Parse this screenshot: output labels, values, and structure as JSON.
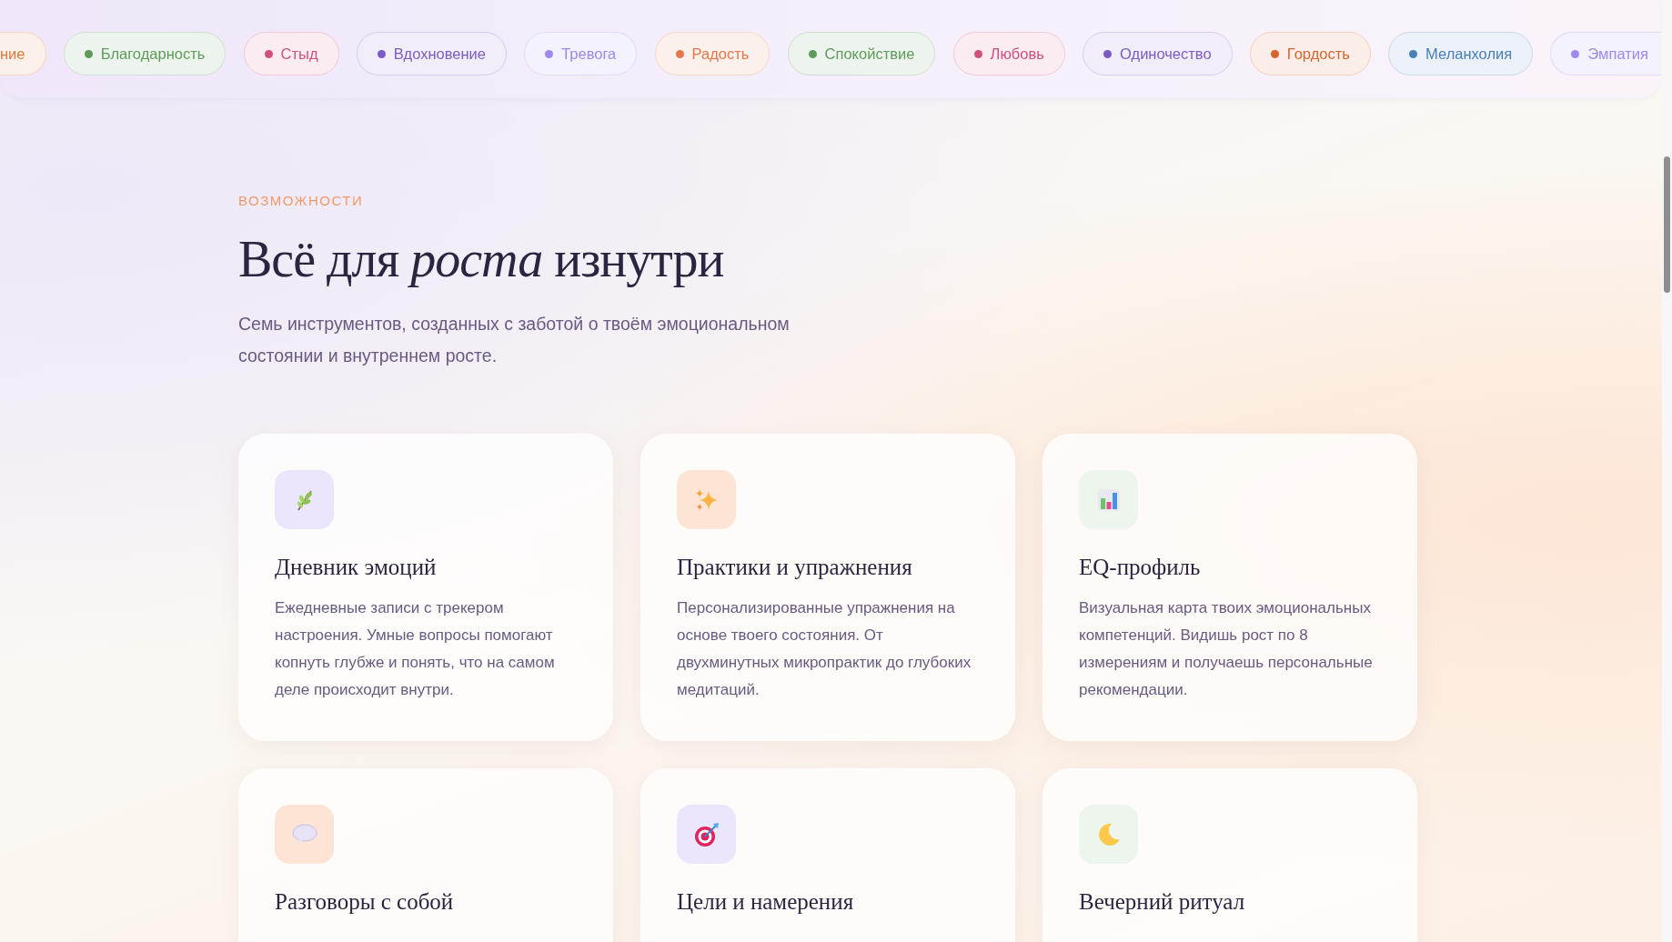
{
  "emotion_chips": [
    {
      "label": "ние",
      "color": "#e07a3f"
    },
    {
      "label": "Благодарность",
      "color": "#5e9a5a"
    },
    {
      "label": "Стыд",
      "color": "#d14f7e"
    },
    {
      "label": "Вдохновение",
      "color": "#7c5cc4"
    },
    {
      "label": "Тревога",
      "color": "#9d88ee"
    },
    {
      "label": "Радость",
      "color": "#e8764a"
    },
    {
      "label": "Спокойствие",
      "color": "#5e9a5a"
    },
    {
      "label": "Любовь",
      "color": "#d14f7e"
    },
    {
      "label": "Одиночество",
      "color": "#7c5cc4"
    },
    {
      "label": "Гордость",
      "color": "#d9632d"
    },
    {
      "label": "Меланхолия",
      "color": "#4a7fb5"
    },
    {
      "label": "Эмпатия",
      "color": "#9d88ee"
    }
  ],
  "section": {
    "eyebrow": "ВОЗМОЖНОСТИ",
    "title": "Всё для *роста* изнутри",
    "subtitle": "Семь инструментов, созданных с заботой о твоём эмоциональном состоянии и внутреннем росте."
  },
  "features": [
    {
      "kind": "sprig",
      "color": "#ece6fd",
      "title": "Дневник эмоций",
      "description": "Ежедневные записи с трекером настроения. Умные вопросы помогают копнуть глубже и понять, что на самом деле происходит внутри."
    },
    {
      "kind": "sparkles",
      "color": "#fde4d4",
      "title": "Практики и упражнения",
      "description": "Персонализированные упражнения на основе твоего состояния. От двухминутных микропрактик до глубоких медитаций."
    },
    {
      "kind": "chart",
      "color": "#eef5ec",
      "title": "EQ-профиль",
      "description": "Визуальная карта твоих эмоциональных компетенций. Видишь рост по 8 измерениям и получаешь персональные рекомендации."
    },
    {
      "kind": "bubble",
      "color": "#fde4d4",
      "title": "Разговоры с собой"
    },
    {
      "kind": "target",
      "color": "#ece6fd",
      "title": "Цели и намерения"
    },
    {
      "kind": "moon",
      "color": "#eef5ec",
      "title": "Вечерний ритуал"
    }
  ]
}
